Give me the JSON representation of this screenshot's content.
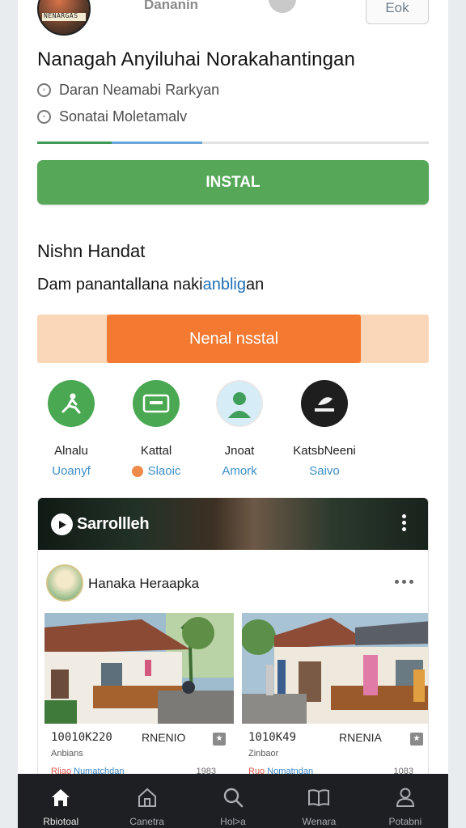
{
  "header": {
    "logo_text": "NENARGAS",
    "developer": "Dananin",
    "ok_label": "Eok"
  },
  "app": {
    "title": "Nanagah Anyiluhai Norakahantingan",
    "meta_1": "Daran Neamabi Rarkyan",
    "meta_2": "Sonatai Moletamalv"
  },
  "install": {
    "label": "INSTAL"
  },
  "section": {
    "title": "Nishn Handat",
    "desc_main": "Dam panantallana naki",
    "desc_highlight": "anblig",
    "desc_tail": "an"
  },
  "promo": {
    "label": "Nenal nsstal"
  },
  "quick_actions": [
    {
      "label": "Alnalu",
      "sub": "Uoanyf",
      "icon": "person-icon",
      "color": "#4aa853"
    },
    {
      "label": "Kattal",
      "sub": "Slaoic",
      "icon": "folder-icon",
      "color": "#4aa853"
    },
    {
      "label": "Jnoat",
      "sub": "Amork",
      "icon": "person-photo-icon",
      "color": "#a9d6f0"
    },
    {
      "label": "KatsbNeeni",
      "sub": "Saivo",
      "icon": "leaf-logo-icon",
      "color": "#1e1e1e"
    }
  ],
  "feed": {
    "banner_title": "Sarrollleh",
    "author": "Hanaka Heraapka",
    "listings": [
      {
        "price": "10010K220",
        "tag": "RNENIO",
        "note": "Anbians",
        "foot_a": "Rliao ",
        "foot_b": "Numatchdan",
        "foot_r": "1983"
      },
      {
        "price": "1010K49",
        "tag": "RNENIA",
        "note": "Zinbaor",
        "foot_a": "Ruo ",
        "foot_b": "Nomatndan",
        "foot_r": "1083"
      }
    ]
  },
  "bottom_nav": [
    {
      "label": "Rbiotoal",
      "icon": "home-icon"
    },
    {
      "label": "Canetra",
      "icon": "store-icon"
    },
    {
      "label": "Hol>a",
      "icon": "search-icon"
    },
    {
      "label": "Wenara",
      "icon": "book-icon"
    },
    {
      "label": "Potabni",
      "icon": "profile-icon"
    }
  ]
}
